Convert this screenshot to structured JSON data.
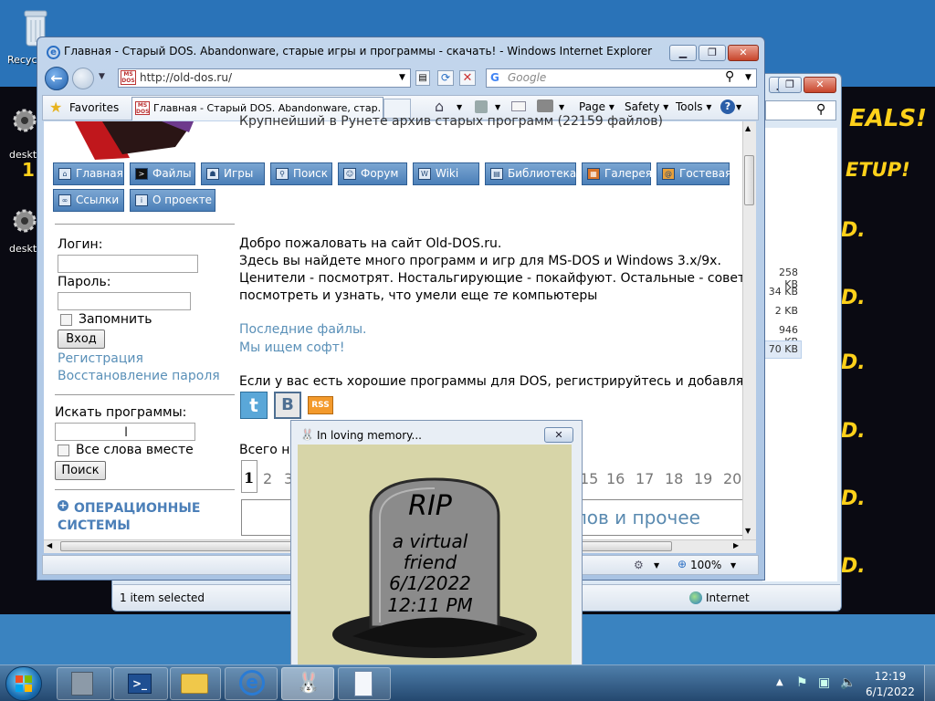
{
  "desktop": {
    "recycle_label": "Recyc",
    "icon2_label": "deskt",
    "icon3_label": "deskt",
    "icon2_mark": "1",
    "promo1": "EALS!",
    "promo2": "ETUP!",
    "promo_dot": "D."
  },
  "bg_window": {
    "status_text": "1 item selected",
    "status_zone": "Internet",
    "file_sizes": [
      "258 KB",
      "34 KB",
      "2 KB",
      "946 KB",
      "70 KB"
    ]
  },
  "ie": {
    "title": "Главная - Старый DOS. Abandonware, старые игры и программы - скачать! - Windows Internet Explorer",
    "address": "http://old-dos.ru/",
    "search_placeholder": "Google",
    "favorites_label": "Favorites",
    "tab_title": "Главная - Старый DOS. Abandonware, стар...",
    "menu_page": "Page",
    "menu_safety": "Safety",
    "menu_tools": "Tools",
    "zoom": "100%",
    "site_logo_mark": "MS DOS"
  },
  "site": {
    "header_tagline": "Крупнейший в Рунете архив старых программ (22159 файлов)",
    "nav": [
      {
        "label": "Главная",
        "icon": "home-icon"
      },
      {
        "label": "Файлы",
        "icon": "terminal-icon"
      },
      {
        "label": "Игры",
        "icon": "invader-icon"
      },
      {
        "label": "Поиск",
        "icon": "search-icon"
      },
      {
        "label": "Форум",
        "icon": "user-icon"
      },
      {
        "label": "Wiki",
        "icon": "wiki-icon"
      },
      {
        "label": "Библиотека",
        "icon": "book-icon"
      },
      {
        "label": "Галерея",
        "icon": "gallery-icon"
      },
      {
        "label": "Гостевая",
        "icon": "guestbook-icon"
      },
      {
        "label": "Ссылки",
        "icon": "link-icon"
      },
      {
        "label": "О проекте",
        "icon": "info-icon"
      }
    ],
    "login_label": "Логин:",
    "password_label": "Пароль:",
    "remember_label": "Запомнить",
    "login_button": "Вход",
    "register_link": "Регистрация",
    "recover_link": "Восстановление пароля",
    "search_label": "Искать программы:",
    "all_words_label": "Все слова вместе",
    "search_button": "Поиск",
    "category": "ОПЕРАЦИОННЫЕ СИСТЕМЫ",
    "category_plus": "+",
    "welcome_1": "Добро пожаловать на сайт Old-DOS.ru.",
    "welcome_2": "Здесь вы найдете много программ и игр для MS-DOS и Windows 3.x/9x.",
    "welcome_3": "Ценители - посмотрят. Ностальгирующие - покайфуют. Остальные - совет",
    "welcome_4a": "посмотреть и узнать, что умели еще ",
    "welcome_4b": "те",
    "welcome_4c": " компьютеры",
    "latest_link": "Последние файлы.",
    "looking_link": "Мы ищем софт!",
    "good_programs": "Если у вас есть хорошие программы для DOS, регистрируйтесь и добавляй",
    "total_text": "Всего н",
    "pages_left": [
      "1",
      "2",
      "3"
    ],
    "pages_right": [
      "15",
      "16",
      "17",
      "18",
      "19",
      "20"
    ],
    "section_tail": "лов и прочее",
    "rss_label": "RSS",
    "vk_label": "В"
  },
  "popup": {
    "title": "In loving memory...",
    "rip": "RIP",
    "line1": "a virtual",
    "line2": "friend",
    "date": "6/1/2022",
    "time": "12:11 PM"
  },
  "taskbar": {
    "time": "12:19",
    "date": "6/1/2022"
  }
}
